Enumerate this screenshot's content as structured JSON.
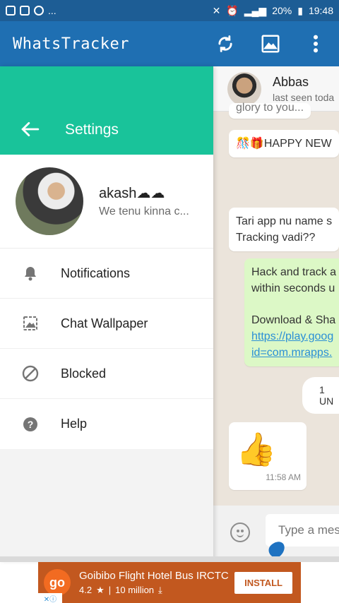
{
  "status_bar": {
    "battery": "20%",
    "time": "19:48",
    "ellipsis": "..."
  },
  "app_bar": {
    "title": "WhatsTracker"
  },
  "drawer": {
    "title": "Settings",
    "profile": {
      "name": "akash☁☁",
      "status": "We tenu kinna c..."
    },
    "items": [
      {
        "label": "Notifications",
        "icon": "bell-icon"
      },
      {
        "label": "Chat Wallpaper",
        "icon": "wallpaper-icon"
      },
      {
        "label": "Blocked",
        "icon": "block-icon"
      },
      {
        "label": "Help",
        "icon": "help-icon"
      }
    ]
  },
  "chat": {
    "contact_name": "Abbas",
    "last_seen": "last seen toda",
    "messages": [
      {
        "text": "glory to you..."
      },
      {
        "text": "🎊🎁HAPPY NEW"
      },
      {
        "line1": "Tari app nu name s",
        "line2": "Tracking vadi??"
      },
      {
        "line1": "Hack and track a",
        "line2": "within seconds u",
        "line3": "Download & Sha",
        "link1": "https://play.goog",
        "link2": "id=com.mrapps."
      },
      {
        "date": "1 UN"
      },
      {
        "emoji": "👍",
        "time": "11:58 AM"
      }
    ],
    "composer_placeholder": "Type a mes"
  },
  "ad": {
    "logo": "go",
    "title": "Goibibo Flight Hotel Bus IRCTC",
    "rating": "4.2",
    "downloads": "10 million",
    "install_label": "INSTALL",
    "adchoices": "✕ⓘ"
  }
}
